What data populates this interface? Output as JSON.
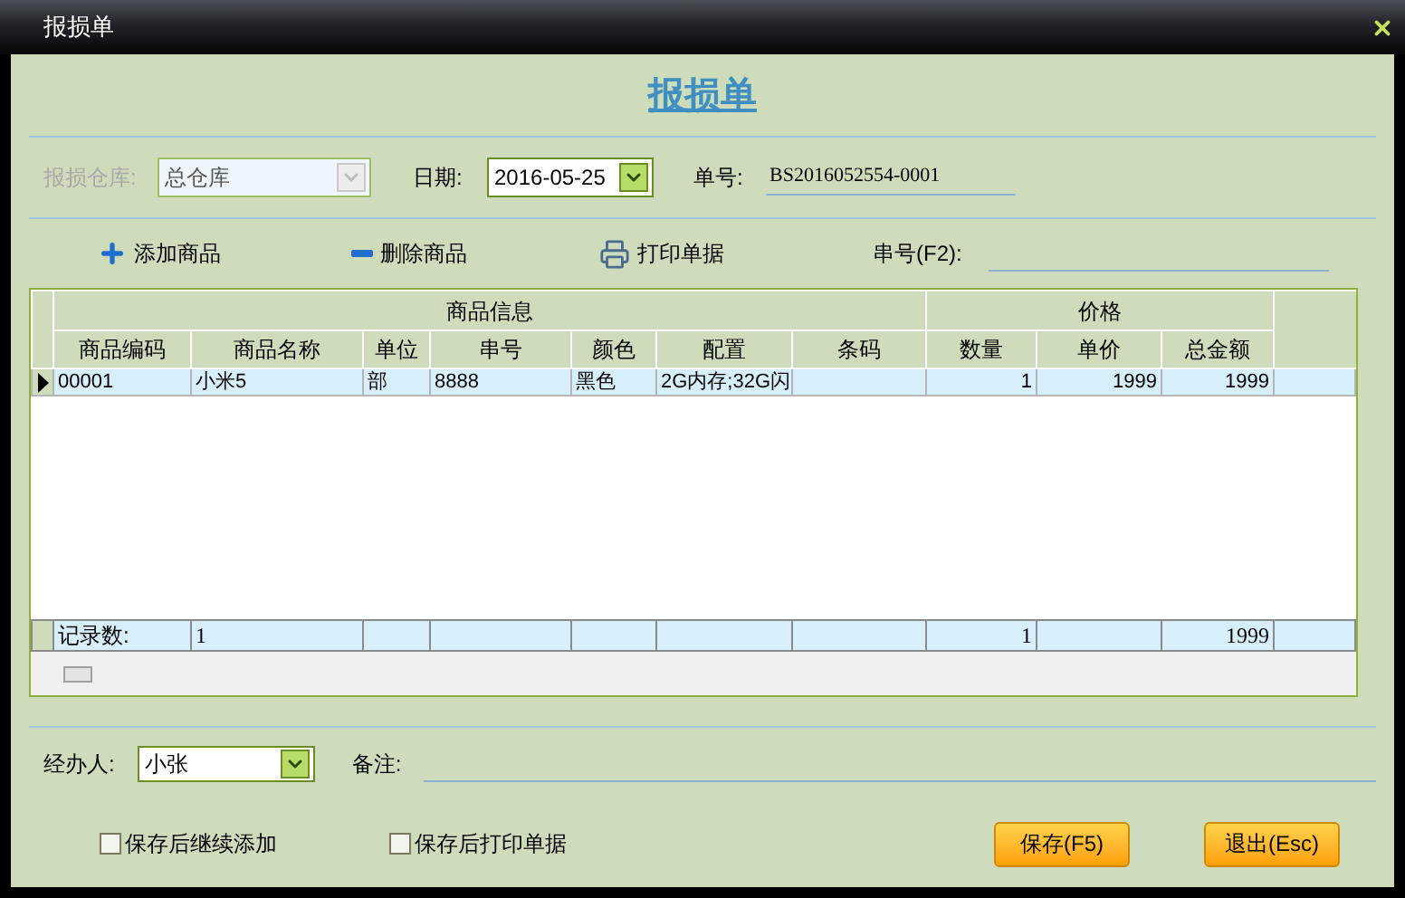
{
  "window": {
    "title": "报损单"
  },
  "heading": "报损单",
  "form": {
    "warehouse": {
      "label": "报损仓库:",
      "value": "总仓库",
      "disabled": true
    },
    "date": {
      "label": "日期:",
      "value": "2016-05-25"
    },
    "number": {
      "label": "单号:",
      "value": "BS2016052554-0001"
    }
  },
  "toolbar": [
    {
      "kind": "add",
      "label": "添加商品"
    },
    {
      "kind": "remove",
      "label": "删除商品"
    },
    {
      "kind": "print",
      "label": "打印单据"
    }
  ],
  "serial": {
    "label": "串号(F2):"
  },
  "table": {
    "groups": [
      {
        "label": "商品信息",
        "columns": [
          {
            "label": "商品编码",
            "footer": "记录数:"
          },
          {
            "label": "商品名称",
            "footer": "1"
          },
          {
            "label": "单位"
          },
          {
            "label": "串号"
          },
          {
            "label": "颜色"
          },
          {
            "label": "配置"
          },
          {
            "label": "条码"
          }
        ]
      },
      {
        "label": "价格",
        "columns": [
          {
            "label": "数量",
            "footer": "1"
          },
          {
            "label": "单价"
          },
          {
            "label": "总金额",
            "footer": "1999"
          }
        ]
      }
    ],
    "rows": [
      {
        "selected": true,
        "cells": [
          "00001",
          "小米5",
          "部",
          "8888",
          "黑色",
          "2G内存;32G闪",
          null,
          "1",
          "1999",
          "1999"
        ]
      }
    ]
  },
  "handler": {
    "label": "经办人:",
    "value": "小张"
  },
  "note": {
    "label": "备注:"
  },
  "options": [
    {
      "label": "保存后继续添加",
      "checked": false
    },
    {
      "label": "保存后打印单据",
      "checked": false
    }
  ],
  "buttons": [
    {
      "label": "保存(F5)"
    },
    {
      "label": "退出(Esc)"
    }
  ]
}
